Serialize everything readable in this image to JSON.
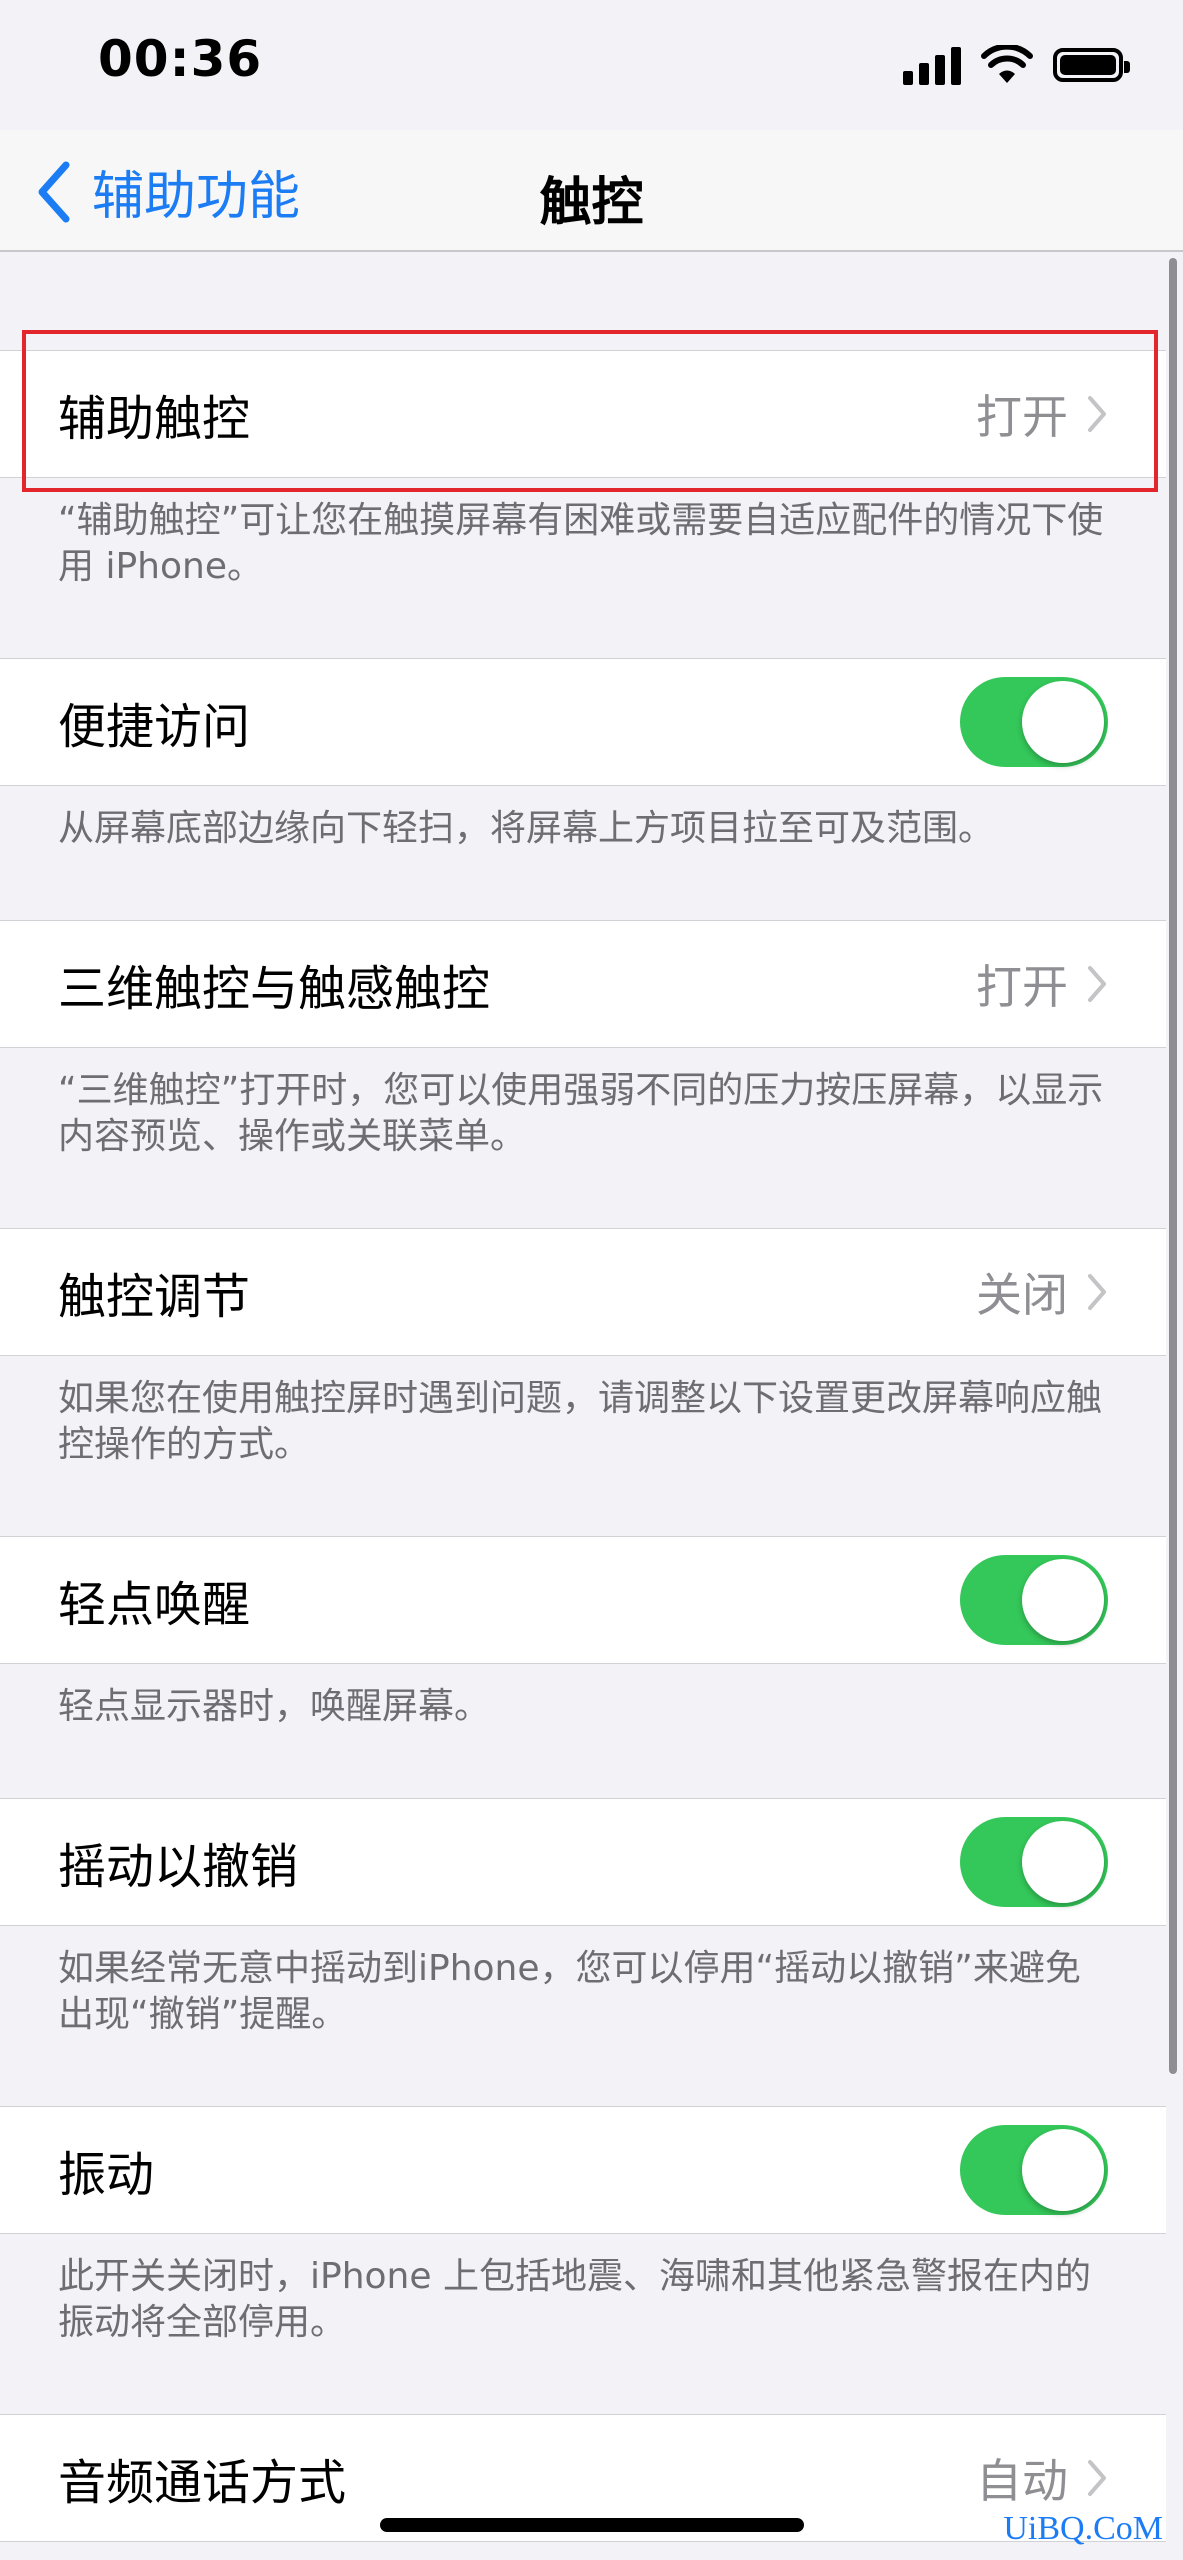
{
  "status_bar": {
    "time": "00:36",
    "icons": [
      "signal-icon",
      "wifi-icon",
      "battery-icon"
    ]
  },
  "nav": {
    "back_label": "辅助功能",
    "title": "触控"
  },
  "sections": [
    {
      "label": "辅助触控",
      "value": "打开",
      "type": "disclosure",
      "footer": "“辅助触控”可让您在触摸屏幕有困难或需要自适应配件的情况下使用 iPhone。"
    },
    {
      "label": "便捷访问",
      "type": "toggle",
      "on": true,
      "footer": "从屏幕底部边缘向下轻扫，将屏幕上方项目拉至可及范围。"
    },
    {
      "label": "三维触控与触感触控",
      "value": "打开",
      "type": "disclosure",
      "footer": "“三维触控”打开时，您可以使用强弱不同的压力按压屏幕，以显示内容预览、操作或关联菜单。"
    },
    {
      "label": "触控调节",
      "value": "关闭",
      "type": "disclosure",
      "footer": "如果您在使用触控屏时遇到问题，请调整以下设置更改屏幕响应触控操作的方式。"
    },
    {
      "label": "轻点唤醒",
      "type": "toggle",
      "on": true,
      "footer": "轻点显示器时，唤醒屏幕。"
    },
    {
      "label": "摇动以撤销",
      "type": "toggle",
      "on": true,
      "footer": "如果经常无意中摇动到iPhone，您可以停用“摇动以撤销”来避免出现“撤销”提醒。"
    },
    {
      "label": "振动",
      "type": "toggle",
      "on": true,
      "footer": "此开关关闭时，iPhone 上包括地震、海啸和其他紧急警报在内的振动将全部停用。"
    },
    {
      "label": "音频通话方式",
      "value": "自动",
      "type": "disclosure",
      "footer": ""
    }
  ],
  "colors": {
    "accent": "#1c7cf4",
    "toggle_on": "#34c759",
    "highlight": "#e2262b"
  },
  "watermark": "UiBQ.CoM"
}
